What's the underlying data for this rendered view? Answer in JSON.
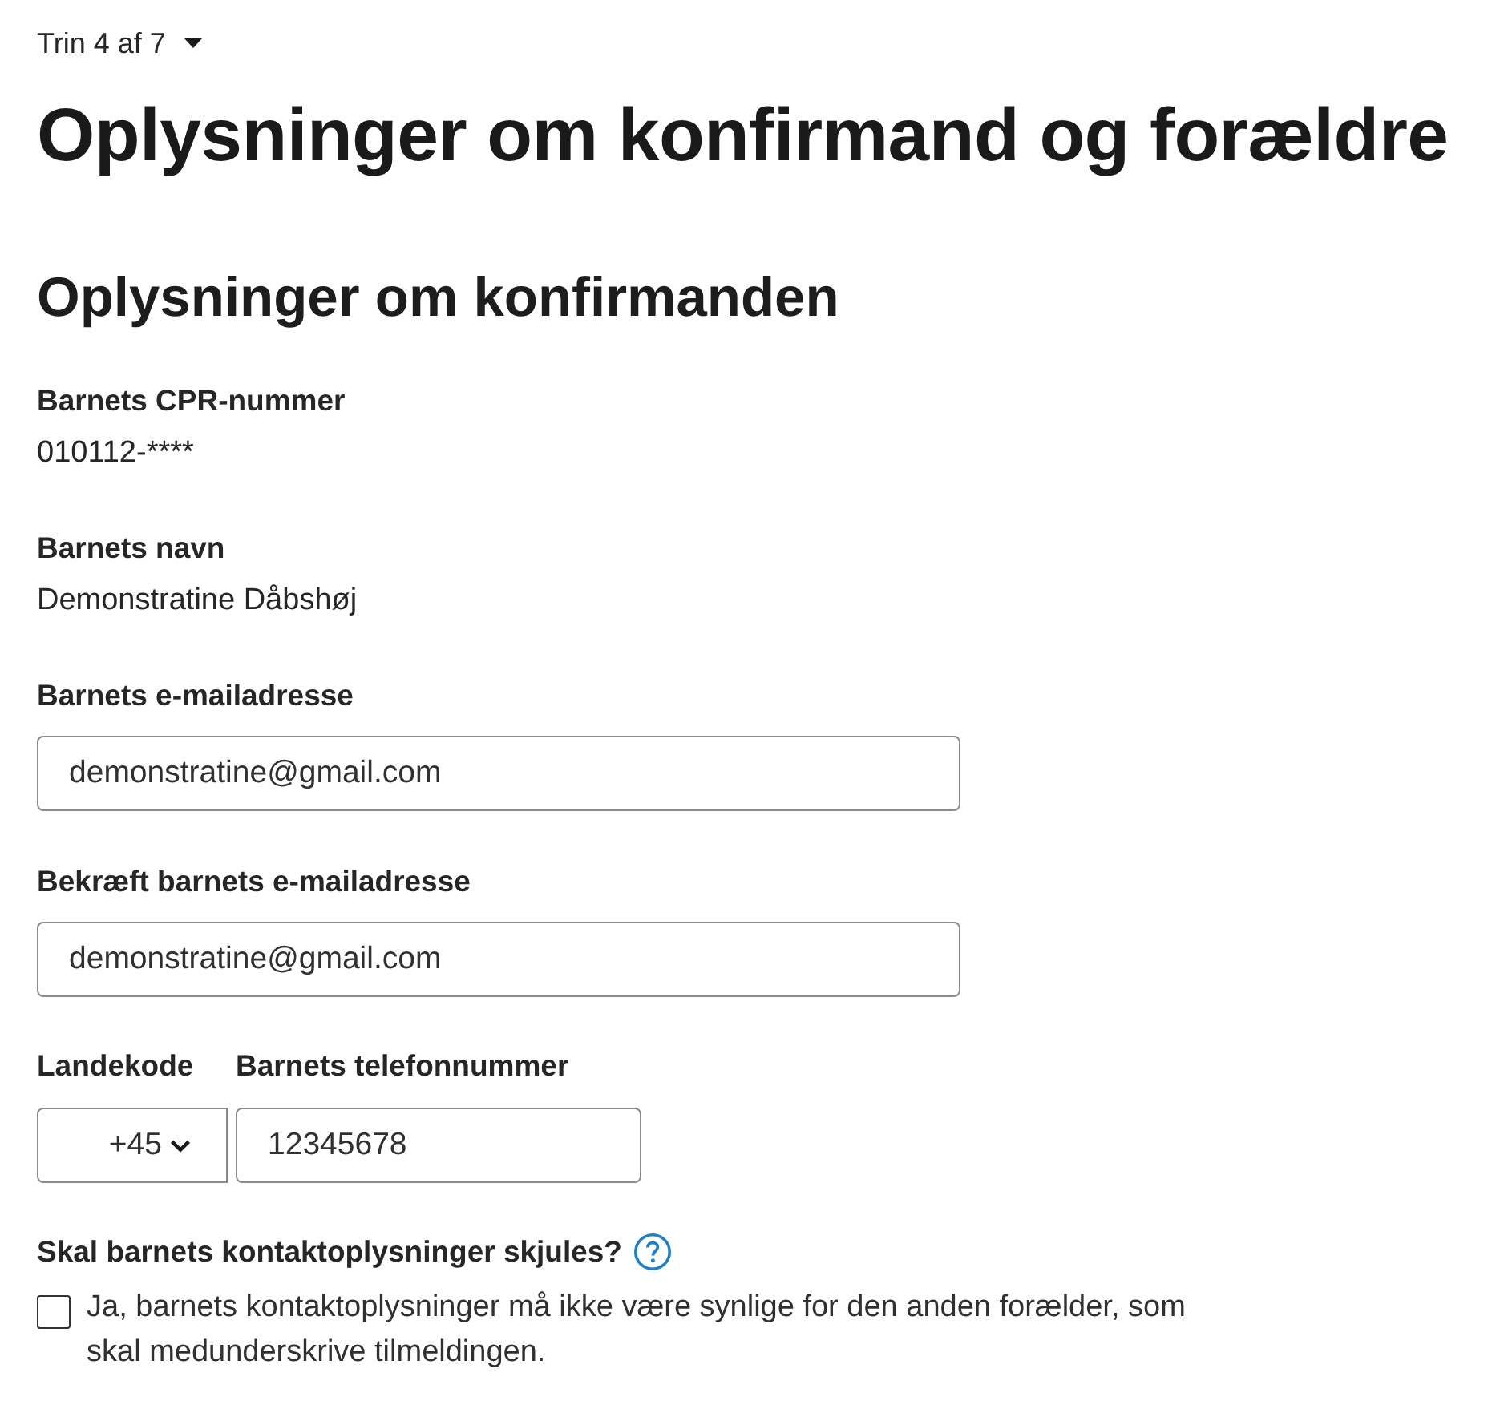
{
  "step_indicator": {
    "text": "Trin 4 af 7"
  },
  "title": "Oplysninger om konfirmand og forældre",
  "section_title": "Oplysninger om konfirmanden",
  "fields": [
    {
      "kind": "readonly",
      "label": "Barnets CPR-nummer",
      "value": "010112-****"
    },
    {
      "kind": "readonly",
      "label": "Barnets navn",
      "value": "Demonstratine Dåbshøj"
    },
    {
      "kind": "input",
      "label": "Barnets e-mailadresse",
      "value": "demonstratine@gmail.com"
    },
    {
      "kind": "input",
      "label": "Bekræft barnets e-mailadresse",
      "value": "demonstratine@gmail.com"
    }
  ],
  "phone": {
    "country_label": "Landekode",
    "country_value": "+45",
    "number_label": "Barnets telefonnummer",
    "number_value": "12345678"
  },
  "hide_contact": {
    "question": "Skal barnets kontaktoplysninger skjules?",
    "checkbox_label": "Ja, barnets kontaktoplysninger må ikke være synlige for den anden forælder, som skal medunderskrive tilmeldingen.",
    "checked": false
  }
}
